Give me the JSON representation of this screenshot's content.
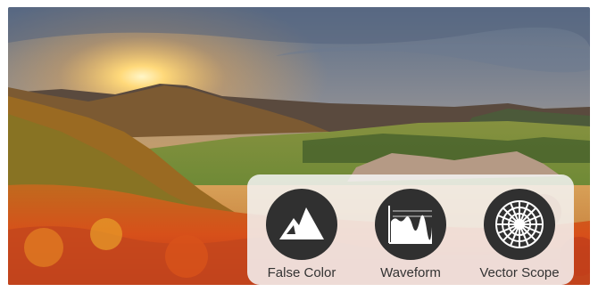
{
  "tools": [
    {
      "label": "False Color",
      "icon": "mountain-icon"
    },
    {
      "label": "Waveform",
      "icon": "waveform-icon"
    },
    {
      "label": "Vector Scope",
      "icon": "vectorscope-icon"
    }
  ]
}
